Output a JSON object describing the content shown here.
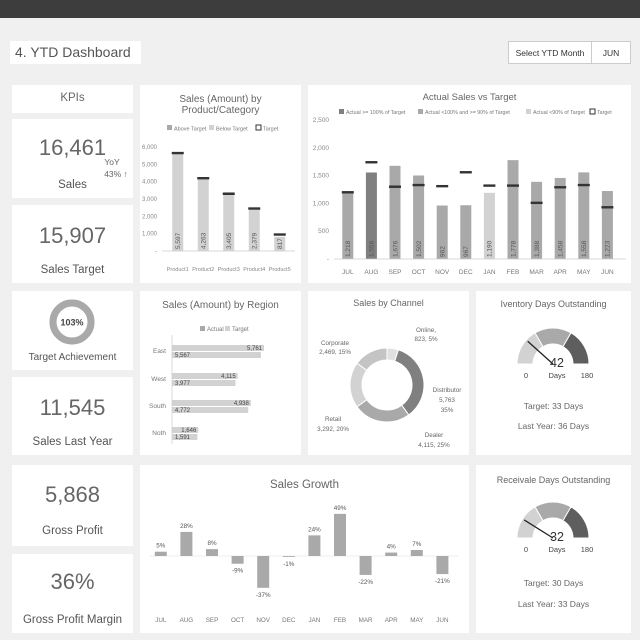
{
  "dashboard": {
    "title": "4. YTD Dashboard",
    "select_label": "Select YTD Month",
    "select_value": "JUN"
  },
  "kpis": {
    "header": "KPIs",
    "sales": {
      "value": "16,461",
      "label": "Sales",
      "yoy_label": "YoY",
      "yoy_value": "43% ↑"
    },
    "sales_target": {
      "value": "15,907",
      "label": "Sales Target"
    },
    "target_achievement": {
      "value": "103%",
      "label": "Target Achievement",
      "fraction": 1.0
    },
    "sales_last_year": {
      "value": "11,545",
      "label": "Sales Last Year"
    },
    "gross_profit": {
      "value": "5,868",
      "label": "Gross Profit"
    },
    "gross_profit_margin": {
      "value": "36%",
      "label": "Gross Profit Margin"
    }
  },
  "colors": {
    "light": "#d2d2d2",
    "mid": "#a9a9a9",
    "dark": "#808080",
    "darker": "#5e5e5e",
    "target": "#333333"
  },
  "chart_data": [
    {
      "id": "product",
      "type": "bar",
      "title": "Sales (Amount) by Product/Category",
      "legend": [
        "Above Target",
        "Below Target",
        "Target"
      ],
      "categories": [
        "Product1",
        "Product2",
        "Product3",
        "Product4",
        "Product5"
      ],
      "values": [
        5597,
        4263,
        3405,
        2379,
        817
      ],
      "value_labels": [
        "5,597",
        "4,263",
        "3,405",
        "2,379",
        "817"
      ],
      "targets": [
        5650,
        4200,
        3300,
        2450,
        950
      ],
      "above": [
        false,
        true,
        true,
        false,
        false
      ],
      "yticks": [
        "6,000",
        "5,000",
        "4,000",
        "3,000",
        "2,000",
        "1,000",
        "-"
      ],
      "ylim": [
        0,
        6000
      ]
    },
    {
      "id": "actual_vs_target",
      "type": "bar",
      "title": "Actual Sales vs Target",
      "legend": [
        "Actual >= 100% of Target",
        "Actual <100% and >= 90% of Target",
        "Actual <90% of Target",
        "Target"
      ],
      "categories": [
        "JUL",
        "AUG",
        "SEP",
        "OCT",
        "NOV",
        "DEC",
        "JAN",
        "FEB",
        "MAR",
        "APR",
        "MAY",
        "JUN"
      ],
      "values": [
        1218,
        1556,
        1676,
        1502,
        962,
        967,
        1190,
        1778,
        1388,
        1458,
        1558,
        1223
      ],
      "value_labels": [
        "1,218",
        "1,556",
        "1,676",
        "1,502",
        "962",
        "967",
        "1,190",
        "1,778",
        "1,388",
        "1,458",
        "1,558",
        "1,223"
      ],
      "targets": [
        1200,
        1740,
        1300,
        1330,
        1310,
        1560,
        1320,
        1320,
        1010,
        1290,
        1330,
        930
      ],
      "tier": [
        2,
        1,
        2,
        2,
        0,
        0,
        3,
        2,
        2,
        2,
        2,
        2
      ],
      "yticks": [
        "2,500",
        "2,000",
        "1,500",
        "1,000",
        "500",
        "-"
      ],
      "ylim": [
        0,
        2500
      ]
    },
    {
      "id": "region",
      "type": "bar",
      "title": "Sales (Amount) by Region",
      "legend": [
        "Actual",
        "Target"
      ],
      "categories": [
        "East",
        "West",
        "South",
        "Noth"
      ],
      "actual": [
        5567,
        3977,
        4772,
        1591
      ],
      "target": [
        5761,
        4115,
        4938,
        1646
      ],
      "actual_labels": [
        "5,567",
        "3,977",
        "4,772",
        "1,591"
      ],
      "target_labels": [
        "5,761",
        "4,115",
        "4,938",
        "1,646"
      ]
    },
    {
      "id": "channel",
      "type": "pie",
      "title": "Sales by Channel",
      "slices": [
        {
          "name": "Online",
          "value": 823,
          "label_name": "Online,",
          "label_value": "823, 5%"
        },
        {
          "name": "Distributor",
          "value": 5763,
          "label_name": "Distributor",
          "label_value": "5,763",
          "label_pct": "35%"
        },
        {
          "name": "Dealer",
          "value": 4115,
          "label_name": "Dealer",
          "label_value": "4,115, 25%"
        },
        {
          "name": "Retail",
          "value": 3292,
          "label_name": "Retail",
          "label_value": "3,292, 20%"
        },
        {
          "name": "Corporate",
          "value": 2469,
          "label_name": "Corporate",
          "label_value": "2,469, 15%"
        }
      ]
    },
    {
      "id": "growth",
      "type": "bar",
      "title": "Sales Growth",
      "categories": [
        "JUL",
        "AUG",
        "SEP",
        "OCT",
        "NOV",
        "DEC",
        "JAN",
        "FEB",
        "MAR",
        "APR",
        "MAY",
        "JUN"
      ],
      "values": [
        5,
        28,
        8,
        -9,
        -37,
        -1,
        24,
        49,
        -22,
        4,
        7,
        -21
      ],
      "value_labels": [
        "5%",
        "28%",
        "8%",
        "-9%",
        "-37%",
        "-1%",
        "24%",
        "49%",
        "-22%",
        "4%",
        "7%",
        "-21%"
      ]
    }
  ],
  "gauges": {
    "inventory": {
      "title": "Iventory Days Outstanding",
      "value": "42",
      "unit": "Days",
      "min": "0",
      "max": "180",
      "fraction": 0.233,
      "target": "Target: 33 Days",
      "last_year": "Last Year: 36 Days"
    },
    "receivable": {
      "title": "Receivale Days Outstanding",
      "value": "32",
      "unit": "Days",
      "min": "0",
      "max": "180",
      "fraction": 0.178,
      "target": "Target: 30 Days",
      "last_year": "Last Year: 33 Days"
    }
  }
}
